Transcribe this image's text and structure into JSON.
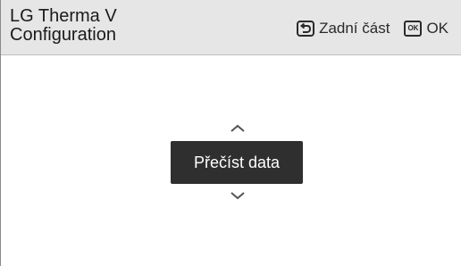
{
  "header": {
    "title_line1": "LG Therma V",
    "title_line2": "Configuration",
    "back_label": "Zadní část",
    "ok_badge": "OK",
    "ok_label": "OK"
  },
  "selector": {
    "current_value": "Přečíst data"
  },
  "icons": {
    "back": "back-arrow-icon",
    "ok": "ok-key-icon",
    "up": "chevron-up-icon",
    "down": "chevron-down-icon"
  }
}
